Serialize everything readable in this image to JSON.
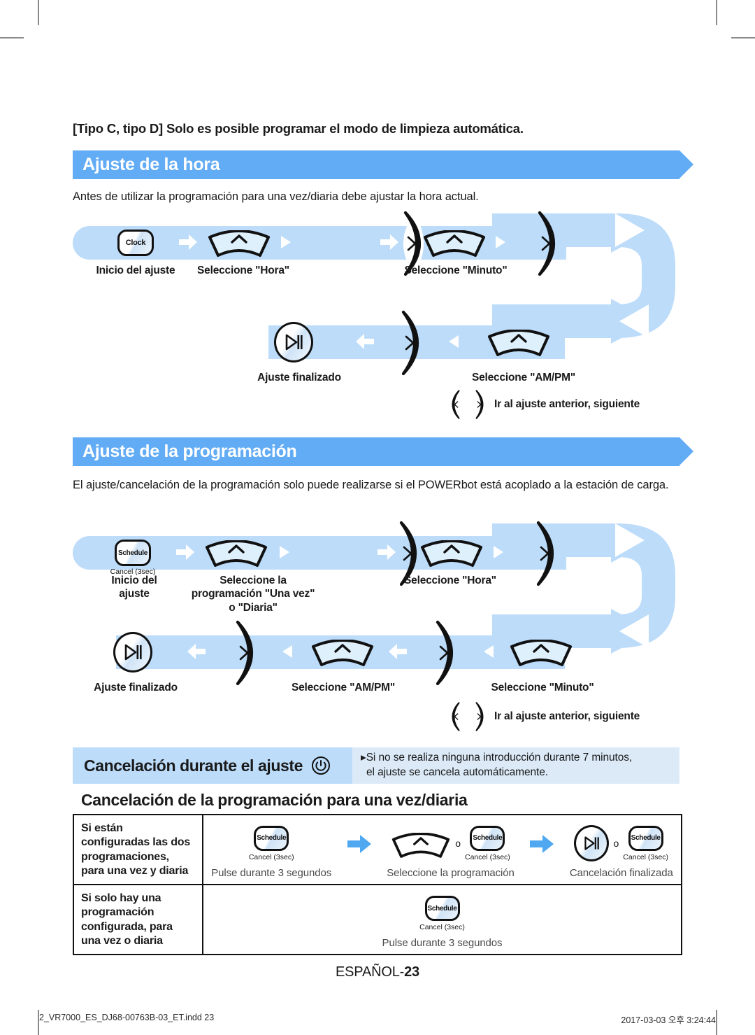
{
  "intro_note": "[Tipo C, tipo D] Solo es posible programar el modo de limpieza automática.",
  "section_clock": {
    "title": "Ajuste de la hora",
    "desc": "Antes de utilizar la programación para una vez/diaria debe ajustar la hora actual.",
    "row1": {
      "btn_clock": "Clock",
      "labels": [
        "Inicio del ajuste",
        "Seleccione \"Hora\"",
        "Seleccione \"Minuto\""
      ]
    },
    "row2": {
      "labels": [
        "Ajuste finalizado",
        "Seleccione \"AM/PM\""
      ]
    },
    "legend": "Ir al ajuste anterior, siguiente"
  },
  "section_schedule": {
    "title": "Ajuste de la programación",
    "desc": "El ajuste/cancelación de la programación solo puede realizarse si el POWERbot está acoplado a la estación de carga.",
    "row1": {
      "btn_schedule": "Schedule",
      "btn_schedule_sub": "Cancel (3sec)",
      "label_start_l1": "Inicio del",
      "label_start_l2": "ajuste",
      "label_select_l1": "Seleccione la",
      "label_select_l2": "programación \"Una vez\"",
      "label_select_l3": "o \"Diaria\"",
      "label_hour": "Seleccione \"Hora\""
    },
    "row2": {
      "label_done": "Ajuste finalizado",
      "label_ampm": "Seleccione \"AM/PM\"",
      "label_minute": "Seleccione \"Minuto\""
    },
    "legend": "Ir al ajuste anterior, siguiente"
  },
  "cancel_strip": {
    "title": "Cancelación durante el ajuste",
    "icon": "power-icon",
    "note_line1": "Si no se realiza ninguna introducción durante 7 minutos,",
    "note_line2": "el ajuste se cancela automáticamente."
  },
  "cancel_table": {
    "subtitle": "Cancelación de la programación para una vez/diaria",
    "rows": [
      {
        "head_lines": [
          "Si están",
          "configuradas las dos",
          "programaciones,",
          "para una vez y diaria"
        ],
        "steps": [
          {
            "caption": "Pulse durante 3 segundos",
            "btn": "Schedule",
            "btn_sub": "Cancel (3sec)",
            "or": ""
          },
          {
            "caption": "Seleccione la programación",
            "btn": "Schedule",
            "btn_sub": "Cancel (3sec)",
            "or": "o"
          },
          {
            "caption": "Cancelación finalizada",
            "btn": "Schedule",
            "btn_sub": "Cancel (3sec)",
            "or": "o"
          }
        ]
      },
      {
        "head_lines": [
          "Si solo hay una",
          "programación",
          "configurada, para",
          "una vez o diaria"
        ],
        "steps": [
          {
            "caption": "Pulse durante 3 segundos",
            "btn": "Schedule",
            "btn_sub": "Cancel (3sec)",
            "or": ""
          }
        ]
      }
    ]
  },
  "page_footer": {
    "page_label": "ESPAÑOL-",
    "page_number": "23",
    "file_name": "2_VR7000_ES_DJ68-00763B-03_ET.indd   23",
    "timestamp": "2017-03-03   오후 3:24:44"
  },
  "colors": {
    "band": "#BCDCFA",
    "header": "#62ACF5",
    "note": "#DCEAF8",
    "blue_arrow": "#4FA8F0"
  }
}
